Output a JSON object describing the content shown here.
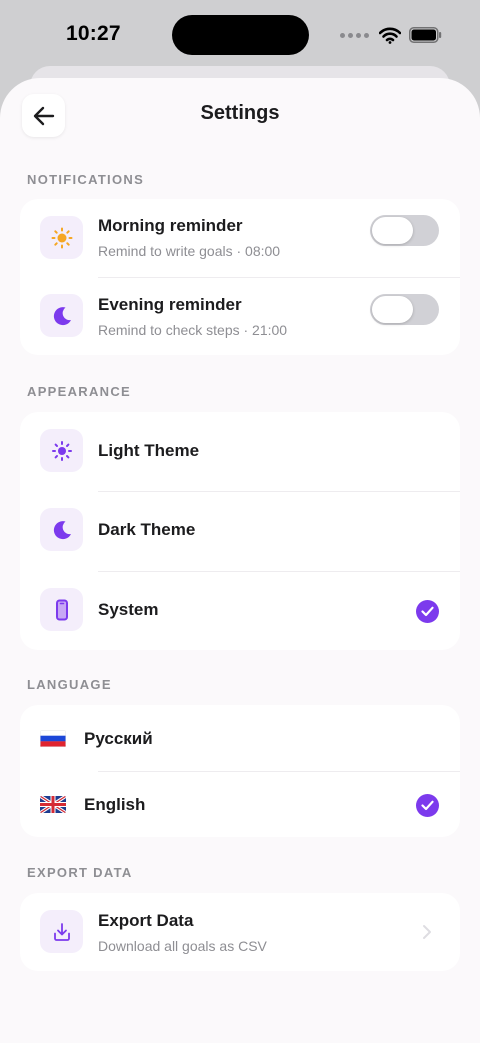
{
  "status_bar": {
    "time": "10:27"
  },
  "header": {
    "title": "Settings"
  },
  "sections": {
    "notifications": {
      "label": "NOTIFICATIONS",
      "morning": {
        "title": "Morning reminder",
        "subtitle": "Remind to write goals · 08:00",
        "enabled": false
      },
      "evening": {
        "title": "Evening reminder",
        "subtitle": "Remind to check steps · 21:00",
        "enabled": false
      }
    },
    "appearance": {
      "label": "APPEARANCE",
      "light": {
        "title": "Light Theme"
      },
      "dark": {
        "title": "Dark Theme"
      },
      "system": {
        "title": "System"
      },
      "selected": "System"
    },
    "language": {
      "label": "LANGUAGE",
      "russian": {
        "title": "Русский"
      },
      "english": {
        "title": "English"
      },
      "selected": "English"
    },
    "export": {
      "label": "EXPORT DATA",
      "item": {
        "title": "Export Data",
        "subtitle": "Download all goals as CSV"
      }
    }
  },
  "colors": {
    "accent": "#7c3aed",
    "sun": "#f5a623",
    "toggle_off": "#d1d1d6"
  },
  "icons": [
    "back-arrow-icon",
    "sun-icon",
    "moon-icon",
    "light-theme-icon",
    "phone-icon",
    "check-icon",
    "russia-flag-icon",
    "uk-flag-icon",
    "download-icon",
    "chevron-right-icon",
    "wifi-icon",
    "battery-icon"
  ]
}
